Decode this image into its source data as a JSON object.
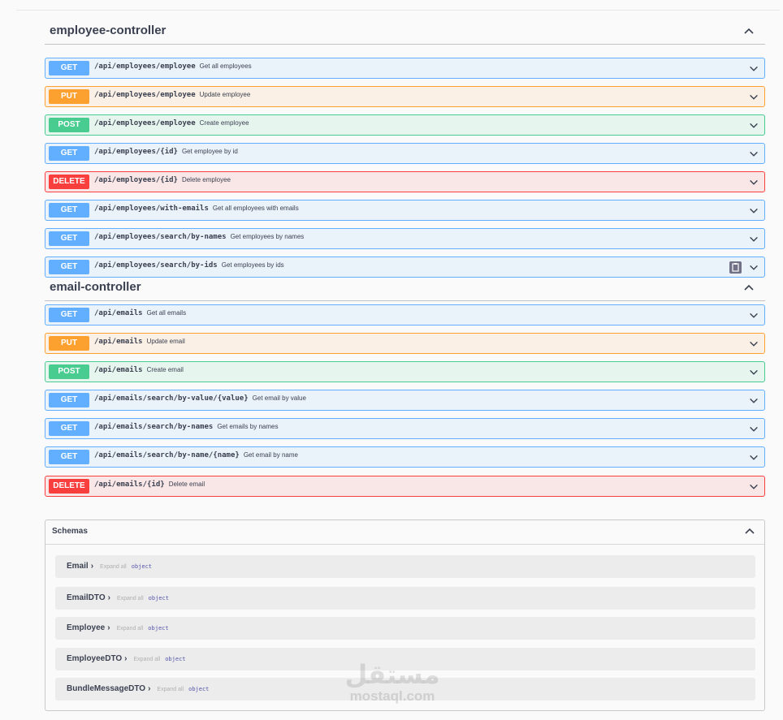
{
  "sections": [
    {
      "title": "employee-controller",
      "operations": [
        {
          "method": "GET",
          "path": "/api/employees/employee",
          "summary": "Get all employees"
        },
        {
          "method": "PUT",
          "path": "/api/employees/employee",
          "summary": "Update employee"
        },
        {
          "method": "POST",
          "path": "/api/employees/employee",
          "summary": "Create employee"
        },
        {
          "method": "GET",
          "path": "/api/employees/{id}",
          "summary": "Get employee by id"
        },
        {
          "method": "DELETE",
          "path": "/api/employees/{id}",
          "summary": "Delete employee"
        },
        {
          "method": "GET",
          "path": "/api/employees/with-emails",
          "summary": "Get all employees with emails"
        },
        {
          "method": "GET",
          "path": "/api/employees/search/by-names",
          "summary": "Get employees by names"
        },
        {
          "method": "GET",
          "path": "/api/employees/search/by-ids",
          "summary": "Get employees by ids"
        }
      ]
    },
    {
      "title": "email-controller",
      "operations": [
        {
          "method": "GET",
          "path": "/api/emails",
          "summary": "Get all emails"
        },
        {
          "method": "PUT",
          "path": "/api/emails",
          "summary": "Update email"
        },
        {
          "method": "POST",
          "path": "/api/emails",
          "summary": "Create email"
        },
        {
          "method": "GET",
          "path": "/api/emails/search/by-value/{value}",
          "summary": "Get email by value"
        },
        {
          "method": "GET",
          "path": "/api/emails/search/by-names",
          "summary": "Get emails by names"
        },
        {
          "method": "GET",
          "path": "/api/emails/search/by-name/{name}",
          "summary": "Get email by name"
        },
        {
          "method": "DELETE",
          "path": "/api/emails/{id}",
          "summary": "Delete email"
        }
      ]
    }
  ],
  "schemas": {
    "title": "Schemas",
    "expand_label": "Expand all",
    "type_label": "object",
    "models": [
      "Email",
      "EmailDTO",
      "Employee",
      "EmployeeDTO",
      "BundleMessageDTO"
    ]
  },
  "watermark": {
    "arabic": "مستقل",
    "latin": "mostaql.com"
  },
  "colors": {
    "get": "#61affe",
    "put": "#fca130",
    "post": "#49cc90",
    "delete": "#f93e3e",
    "text": "#3b4151"
  },
  "icons": {
    "collapse": "chevron-up-icon",
    "expand": "chevron-down-icon",
    "model_expand": "chevron-right-icon",
    "copy": "clipboard-icon"
  }
}
